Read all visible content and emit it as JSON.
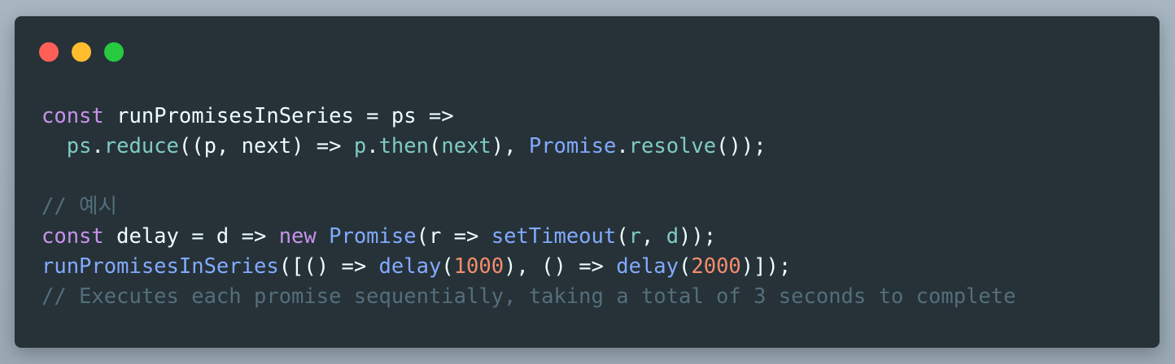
{
  "window": {
    "controls": {
      "close_color": "#ff5f56",
      "minimize_color": "#ffbd2e",
      "maximize_color": "#27c93f"
    }
  },
  "code": {
    "line1": {
      "t1": "const",
      "t2": " runPromisesInSeries = ps =>"
    },
    "line2": {
      "t1": "  ",
      "t2": "ps",
      "t3": ".",
      "t4": "reduce",
      "t5": "((p, next) => ",
      "t6": "p",
      "t7": ".",
      "t8": "then",
      "t9": "(",
      "t10": "next",
      "t11": "), ",
      "t12": "Promise",
      "t13": ".",
      "t14": "resolve",
      "t15": "());"
    },
    "line3": "",
    "line4": "// 예시",
    "line5": {
      "t1": "const",
      "t2": " delay = d => ",
      "t3": "new",
      "t4": " ",
      "t5": "Promise",
      "t6": "(r => ",
      "t7": "setTimeout",
      "t8": "(",
      "t9": "r",
      "t10": ", ",
      "t11": "d",
      "t12": "));"
    },
    "line6": {
      "t1": "runPromisesInSeries",
      "t2": "([() => ",
      "t3": "delay",
      "t4": "(",
      "t5": "1000",
      "t6": "), () => ",
      "t7": "delay",
      "t8": "(",
      "t9": "2000",
      "t10": ")]);"
    },
    "line7": "// Executes each promise sequentially, taking a total of 3 seconds to complete"
  },
  "colors": {
    "background": "#263238",
    "keyword": "#c792ea",
    "function": "#82aaff",
    "property": "#80cbc4",
    "number": "#f78c6c",
    "comment": "#546e7a",
    "text": "#eeffff"
  }
}
